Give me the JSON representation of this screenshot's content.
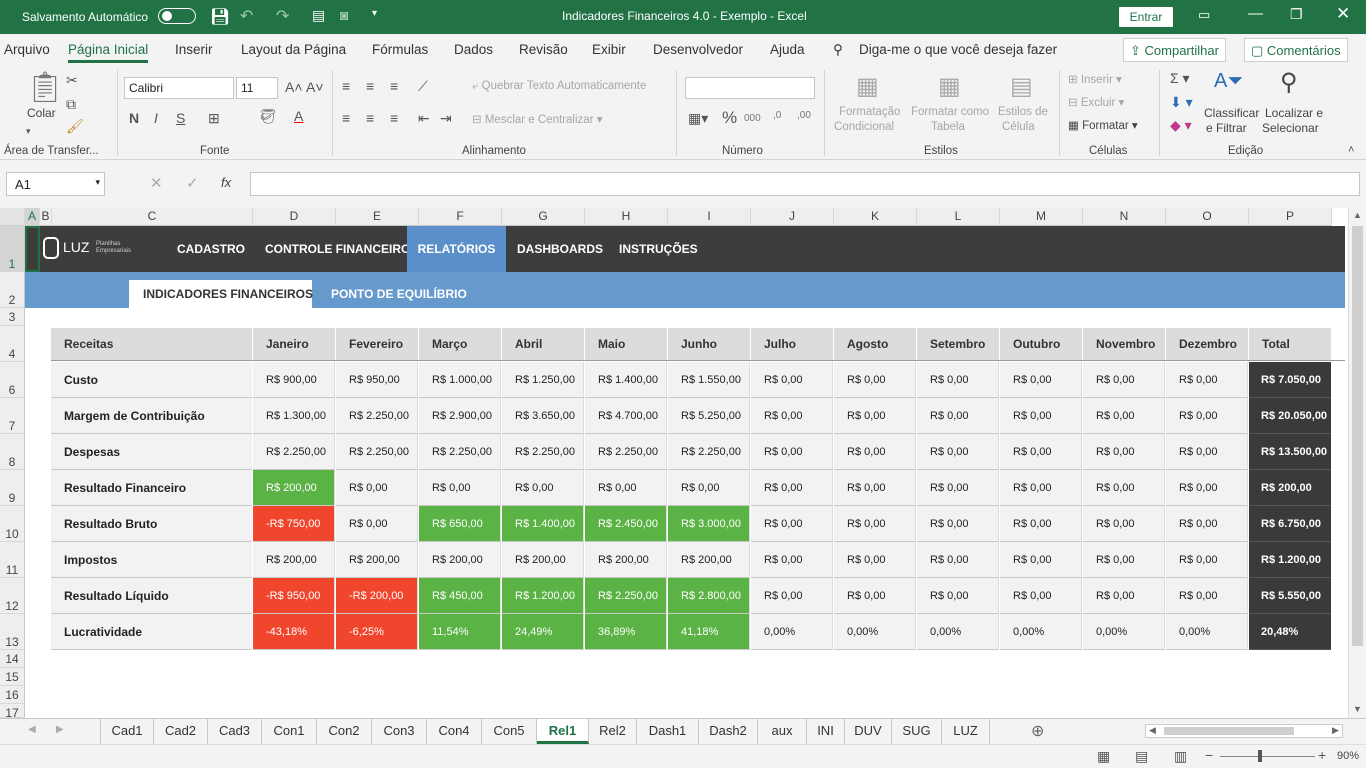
{
  "titlebar": {
    "autosave_label": "Salvamento Automático",
    "title": "Indicadores Financeiros 4.0 - Exemplo  -  Excel",
    "signin": "Entrar"
  },
  "menu": {
    "items": [
      "Arquivo",
      "Página Inicial",
      "Inserir",
      "Layout da Página",
      "Fórmulas",
      "Dados",
      "Revisão",
      "Exibir",
      "Desenvolvedor",
      "Ajuda"
    ],
    "tellme": "Diga-me o que você deseja fazer",
    "share": "Compartilhar",
    "comments": "Comentários"
  },
  "ribbon": {
    "paste": "Colar",
    "clipboard": "Área de Transfer...",
    "font_name": "Calibri",
    "font_size": "11",
    "bold": "N",
    "italic": "I",
    "underline": "S",
    "font_group": "Fonte",
    "wrap": "Quebrar Texto Automaticamente",
    "merge": "Mesclar e Centralizar",
    "align_group": "Alinhamento",
    "number_group": "Número",
    "cond_format_1": "Formatação",
    "cond_format_2": "Condicional",
    "format_table_1": "Formatar como",
    "format_table_2": "Tabela",
    "cell_styles_1": "Estilos de",
    "cell_styles_2": "Célula",
    "styles_group": "Estilos",
    "insert": "Inserir",
    "delete": "Excluir",
    "format": "Formatar",
    "cells_group": "Células",
    "sort_1": "Classificar",
    "sort_2": "e Filtrar",
    "find_1": "Localizar e",
    "find_2": "Selecionar",
    "editing_group": "Edição"
  },
  "formula_bar": {
    "namebox": "A1",
    "fx": "fx",
    "value": ""
  },
  "columns": [
    "A",
    "B",
    "C",
    "D",
    "E",
    "F",
    "G",
    "H",
    "I",
    "J",
    "K",
    "L",
    "M",
    "N",
    "O",
    "P"
  ],
  "rows": [
    "1",
    "2",
    "3",
    "4",
    "6",
    "7",
    "8",
    "9",
    "10",
    "11",
    "12",
    "13",
    "14",
    "15",
    "16",
    "17"
  ],
  "nav": {
    "logo": "LUZ",
    "logo_sub1": "Planilhas",
    "logo_sub2": "Empresariais",
    "items": [
      "CADASTRO",
      "CONTROLE FINANCEIRO",
      "RELATÓRIOS",
      "DASHBOARDS",
      "INSTRUÇÕES"
    ],
    "selected": "RELATÓRIOS"
  },
  "subnav": {
    "tabs": [
      "INDICADORES FINANCEIROS",
      "PONTO DE EQUILÍBRIO"
    ],
    "selected": "INDICADORES FINANCEIROS"
  },
  "table": {
    "headers": [
      "Receitas",
      "Janeiro",
      "Fevereiro",
      "Março",
      "Abril",
      "Maio",
      "Junho",
      "Julho",
      "Agosto",
      "Setembro",
      "Outubro",
      "Novembro",
      "Dezembro",
      "Total"
    ],
    "rows": [
      {
        "label": "Custo",
        "values": [
          "R$ 900,00",
          "R$ 950,00",
          "R$ 1.000,00",
          "R$ 1.250,00",
          "R$ 1.400,00",
          "R$ 1.550,00",
          "R$ 0,00",
          "R$ 0,00",
          "R$ 0,00",
          "R$ 0,00",
          "R$ 0,00",
          "R$ 0,00"
        ],
        "total": "R$ 7.050,00",
        "status": [
          "n",
          "n",
          "n",
          "n",
          "n",
          "n",
          "n",
          "n",
          "n",
          "n",
          "n",
          "n"
        ]
      },
      {
        "label": "Margem de Contribuição",
        "values": [
          "R$ 1.300,00",
          "R$ 2.250,00",
          "R$ 2.900,00",
          "R$ 3.650,00",
          "R$ 4.700,00",
          "R$ 5.250,00",
          "R$ 0,00",
          "R$ 0,00",
          "R$ 0,00",
          "R$ 0,00",
          "R$ 0,00",
          "R$ 0,00"
        ],
        "total": "R$ 20.050,00",
        "status": [
          "n",
          "n",
          "n",
          "n",
          "n",
          "n",
          "n",
          "n",
          "n",
          "n",
          "n",
          "n"
        ]
      },
      {
        "label": "Despesas",
        "values": [
          "R$ 2.250,00",
          "R$ 2.250,00",
          "R$ 2.250,00",
          "R$ 2.250,00",
          "R$ 2.250,00",
          "R$ 2.250,00",
          "R$ 0,00",
          "R$ 0,00",
          "R$ 0,00",
          "R$ 0,00",
          "R$ 0,00",
          "R$ 0,00"
        ],
        "total": "R$ 13.500,00",
        "status": [
          "n",
          "n",
          "n",
          "n",
          "n",
          "n",
          "n",
          "n",
          "n",
          "n",
          "n",
          "n"
        ]
      },
      {
        "label": "Resultado Financeiro",
        "values": [
          "R$ 200,00",
          "R$ 0,00",
          "R$ 0,00",
          "R$ 0,00",
          "R$ 0,00",
          "R$ 0,00",
          "R$ 0,00",
          "R$ 0,00",
          "R$ 0,00",
          "R$ 0,00",
          "R$ 0,00",
          "R$ 0,00"
        ],
        "total": "R$ 200,00",
        "status": [
          "g",
          "n",
          "n",
          "n",
          "n",
          "n",
          "n",
          "n",
          "n",
          "n",
          "n",
          "n"
        ]
      },
      {
        "label": "Resultado Bruto",
        "values": [
          "-R$ 750,00",
          "R$ 0,00",
          "R$ 650,00",
          "R$ 1.400,00",
          "R$ 2.450,00",
          "R$ 3.000,00",
          "R$ 0,00",
          "R$ 0,00",
          "R$ 0,00",
          "R$ 0,00",
          "R$ 0,00",
          "R$ 0,00"
        ],
        "total": "R$ 6.750,00",
        "status": [
          "r",
          "n",
          "g",
          "g",
          "g",
          "g",
          "n",
          "n",
          "n",
          "n",
          "n",
          "n"
        ]
      },
      {
        "label": "Impostos",
        "values": [
          "R$ 200,00",
          "R$ 200,00",
          "R$ 200,00",
          "R$ 200,00",
          "R$ 200,00",
          "R$ 200,00",
          "R$ 0,00",
          "R$ 0,00",
          "R$ 0,00",
          "R$ 0,00",
          "R$ 0,00",
          "R$ 0,00"
        ],
        "total": "R$ 1.200,00",
        "status": [
          "n",
          "n",
          "n",
          "n",
          "n",
          "n",
          "n",
          "n",
          "n",
          "n",
          "n",
          "n"
        ]
      },
      {
        "label": "Resultado Líquido",
        "values": [
          "-R$ 950,00",
          "-R$ 200,00",
          "R$ 450,00",
          "R$ 1.200,00",
          "R$ 2.250,00",
          "R$ 2.800,00",
          "R$ 0,00",
          "R$ 0,00",
          "R$ 0,00",
          "R$ 0,00",
          "R$ 0,00",
          "R$ 0,00"
        ],
        "total": "R$ 5.550,00",
        "status": [
          "r",
          "r",
          "g",
          "g",
          "g",
          "g",
          "n",
          "n",
          "n",
          "n",
          "n",
          "n"
        ]
      },
      {
        "label": "Lucratividade",
        "values": [
          "-43,18%",
          "-6,25%",
          "11,54%",
          "24,49%",
          "36,89%",
          "41,18%",
          "0,00%",
          "0,00%",
          "0,00%",
          "0,00%",
          "0,00%",
          "0,00%"
        ],
        "total": "20,48%",
        "status": [
          "r",
          "r",
          "g",
          "g",
          "g",
          "g",
          "n",
          "n",
          "n",
          "n",
          "n",
          "n"
        ]
      }
    ]
  },
  "colors": {
    "green": "#5bb346",
    "red": "#f0462d",
    "total_bg": "#3a3a3a",
    "excel_green": "#217346",
    "nav_bg": "#3d3d3d",
    "nav_sel": "#5b8fc9",
    "subnav": "#6699cc"
  },
  "sheet_tabs": [
    "Cad1",
    "Cad2",
    "Cad3",
    "Con1",
    "Con2",
    "Con3",
    "Con4",
    "Con5",
    "Rel1",
    "Rel2",
    "Dash1",
    "Dash2",
    "aux",
    "INI",
    "DUV",
    "SUG",
    "LUZ"
  ],
  "active_sheet": "Rel1",
  "status": {
    "zoom": "90%"
  }
}
